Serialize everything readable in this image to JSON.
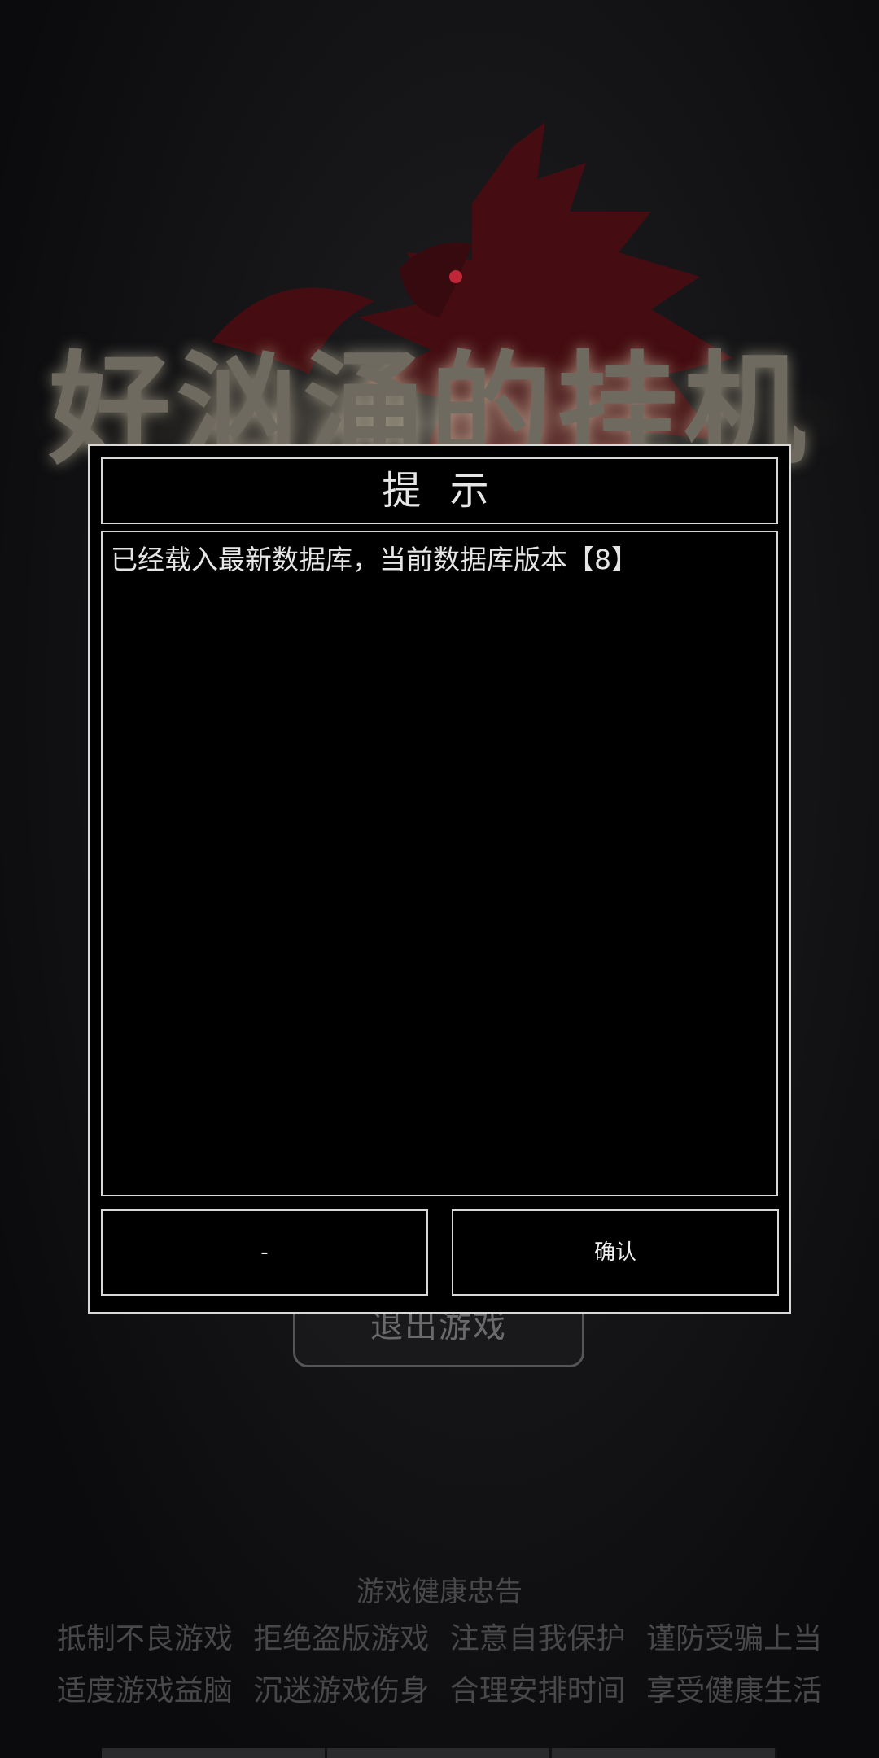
{
  "game": {
    "title": "好汹涌的挂机",
    "exit_label": "退出游戏"
  },
  "dialog": {
    "title": "提 示",
    "message": "已经载入最新数据库，当前数据库版本【8】",
    "left_button": "-",
    "right_button": "确认"
  },
  "health_notice": {
    "title": "游戏健康忠告",
    "line1": "抵制不良游戏 拒绝盗版游戏 注意自我保护 谨防受骗上当",
    "line2": "适度游戏益脑 沉迷游戏伤身 合理安排时间 享受健康生活"
  },
  "colors": {
    "dragon": "#5a0f14",
    "dialog_border": "#d8d8d8",
    "dialog_bg": "#000000"
  },
  "icons": {
    "dragon": "dragon-emblem"
  }
}
